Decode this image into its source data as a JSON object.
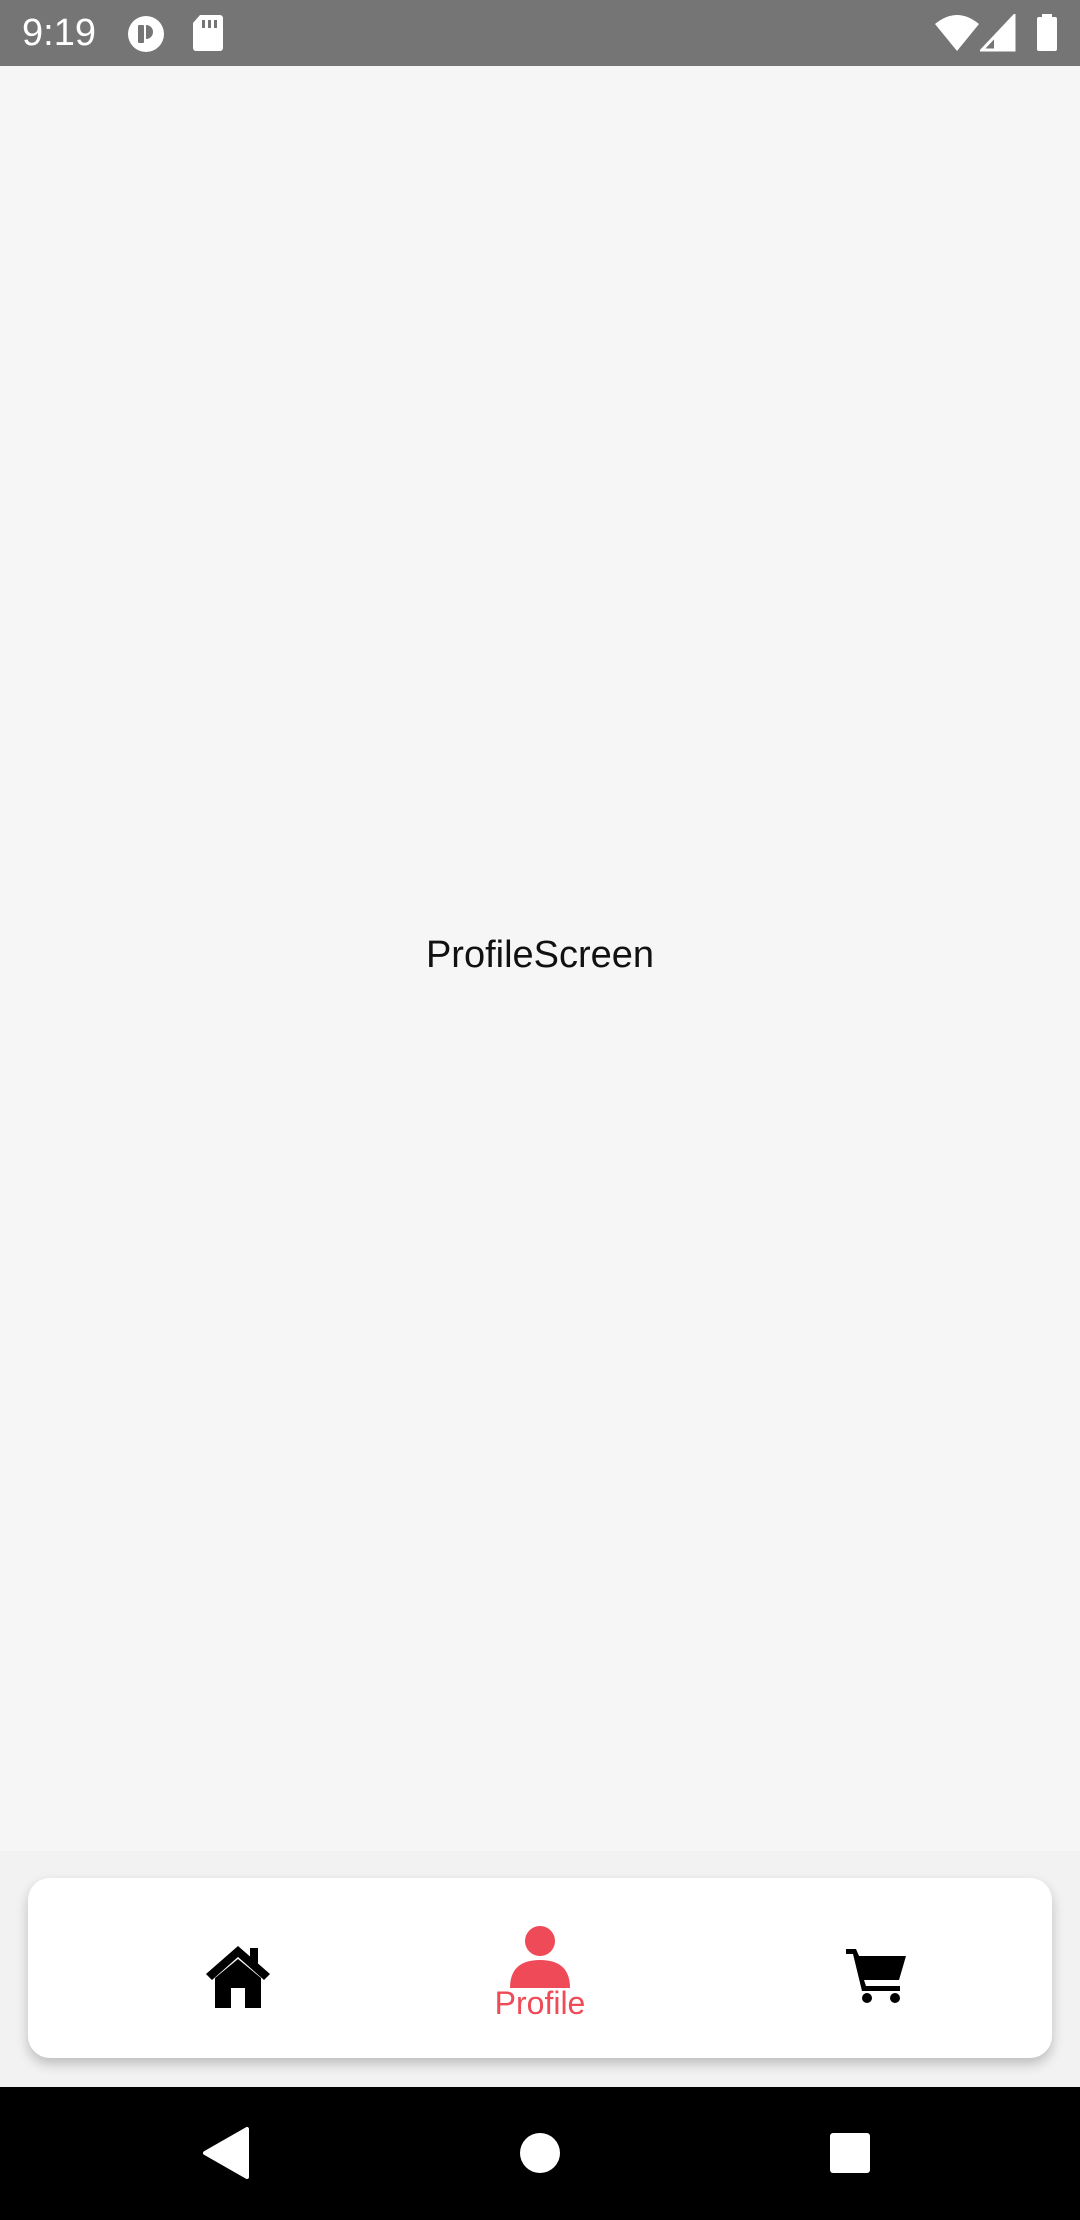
{
  "status_bar": {
    "time": "9:19",
    "icons": [
      "app-notification-icon",
      "sd-card-icon",
      "wifi-icon",
      "cellular-signal-icon",
      "battery-icon"
    ]
  },
  "main": {
    "screen_label": "ProfileScreen"
  },
  "tab_bar": {
    "tabs": [
      {
        "id": "home",
        "icon": "home-icon",
        "label": "",
        "active": false
      },
      {
        "id": "profile",
        "icon": "person-icon",
        "label": "Profile",
        "active": true
      },
      {
        "id": "cart",
        "icon": "shopping-cart-icon",
        "label": "",
        "active": false
      }
    ]
  },
  "nav_bar": {
    "buttons": [
      "back-icon",
      "home-circle-icon",
      "recents-icon"
    ]
  },
  "colors": {
    "accent": "#ef4a57",
    "status_bar": "#757575",
    "background": "#f6f6f6",
    "nav_bar": "#000000",
    "tab_bar": "#ffffff"
  }
}
